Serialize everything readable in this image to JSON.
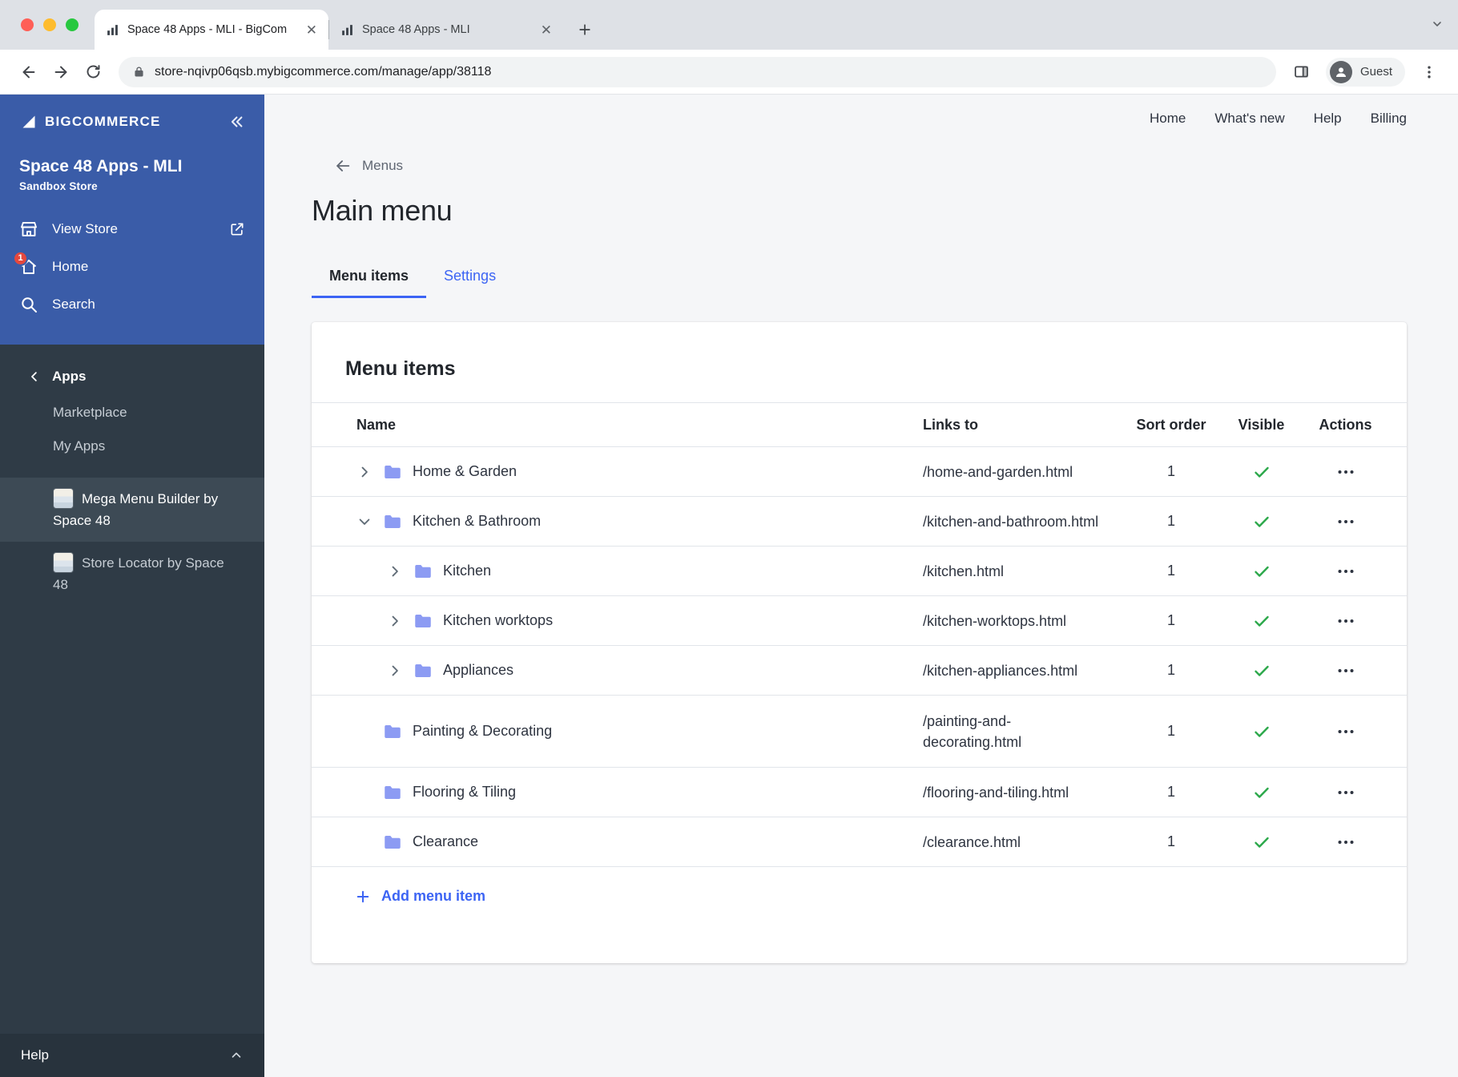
{
  "browser": {
    "tabs": [
      {
        "title": "Space 48 Apps - MLI - BigCom"
      },
      {
        "title": "Space 48 Apps - MLI"
      }
    ],
    "url": "store-nqivp06qsb.mybigcommerce.com/manage/app/38118",
    "guest": "Guest"
  },
  "sidebar": {
    "brand": "BIGCOMMERCE",
    "store_name": "Space 48 Apps - MLI",
    "store_type": "Sandbox Store",
    "nav": {
      "view_store": "View Store",
      "home": "Home",
      "home_badge": "1",
      "search": "Search"
    },
    "apps_header": "Apps",
    "items": {
      "marketplace": "Marketplace",
      "my_apps": "My Apps"
    },
    "apps": [
      {
        "label": "Mega Menu Builder by Space 48"
      },
      {
        "label": "Store Locator by Space 48"
      }
    ],
    "help": "Help"
  },
  "topnav": {
    "home": "Home",
    "whats_new": "What's new",
    "help": "Help",
    "billing": "Billing"
  },
  "page": {
    "breadcrumb": "Menus",
    "title": "Main menu",
    "tabs": {
      "menu_items": "Menu items",
      "settings": "Settings"
    },
    "card_heading": "Menu items",
    "add_item": "Add menu item"
  },
  "table": {
    "headers": {
      "name": "Name",
      "links_to": "Links to",
      "sort_order": "Sort order",
      "visible": "Visible",
      "actions": "Actions"
    },
    "rows": [
      {
        "name": "Home & Garden",
        "links_to": "/home-and-garden.html",
        "sort_order": "1",
        "visible": true
      },
      {
        "name": "Kitchen & Bathroom",
        "links_to": "/kitchen-and-bathroom.html",
        "sort_order": "1",
        "visible": true
      },
      {
        "name": "Kitchen",
        "links_to": "/kitchen.html",
        "sort_order": "1",
        "visible": true
      },
      {
        "name": "Kitchen worktops",
        "links_to": "/kitchen-worktops.html",
        "sort_order": "1",
        "visible": true
      },
      {
        "name": "Appliances",
        "links_to": "/kitchen-appliances.html",
        "sort_order": "1",
        "visible": true
      },
      {
        "name": "Painting & Decorating",
        "links_to": "/painting-and-decorating.html",
        "sort_order": "1",
        "visible": true
      },
      {
        "name": "Flooring & Tiling",
        "links_to": "/flooring-and-tiling.html",
        "sort_order": "1",
        "visible": true
      },
      {
        "name": "Clearance",
        "links_to": "/clearance.html",
        "sort_order": "1",
        "visible": true
      }
    ]
  },
  "colors": {
    "accent_blue": "#3C64F4",
    "sidebar_blue": "#3A5CA8",
    "sidebar_dark": "#2F3B46",
    "success_green": "#2BA84A",
    "badge_red": "#E5483D",
    "folder_blue": "#8C9BF3"
  }
}
